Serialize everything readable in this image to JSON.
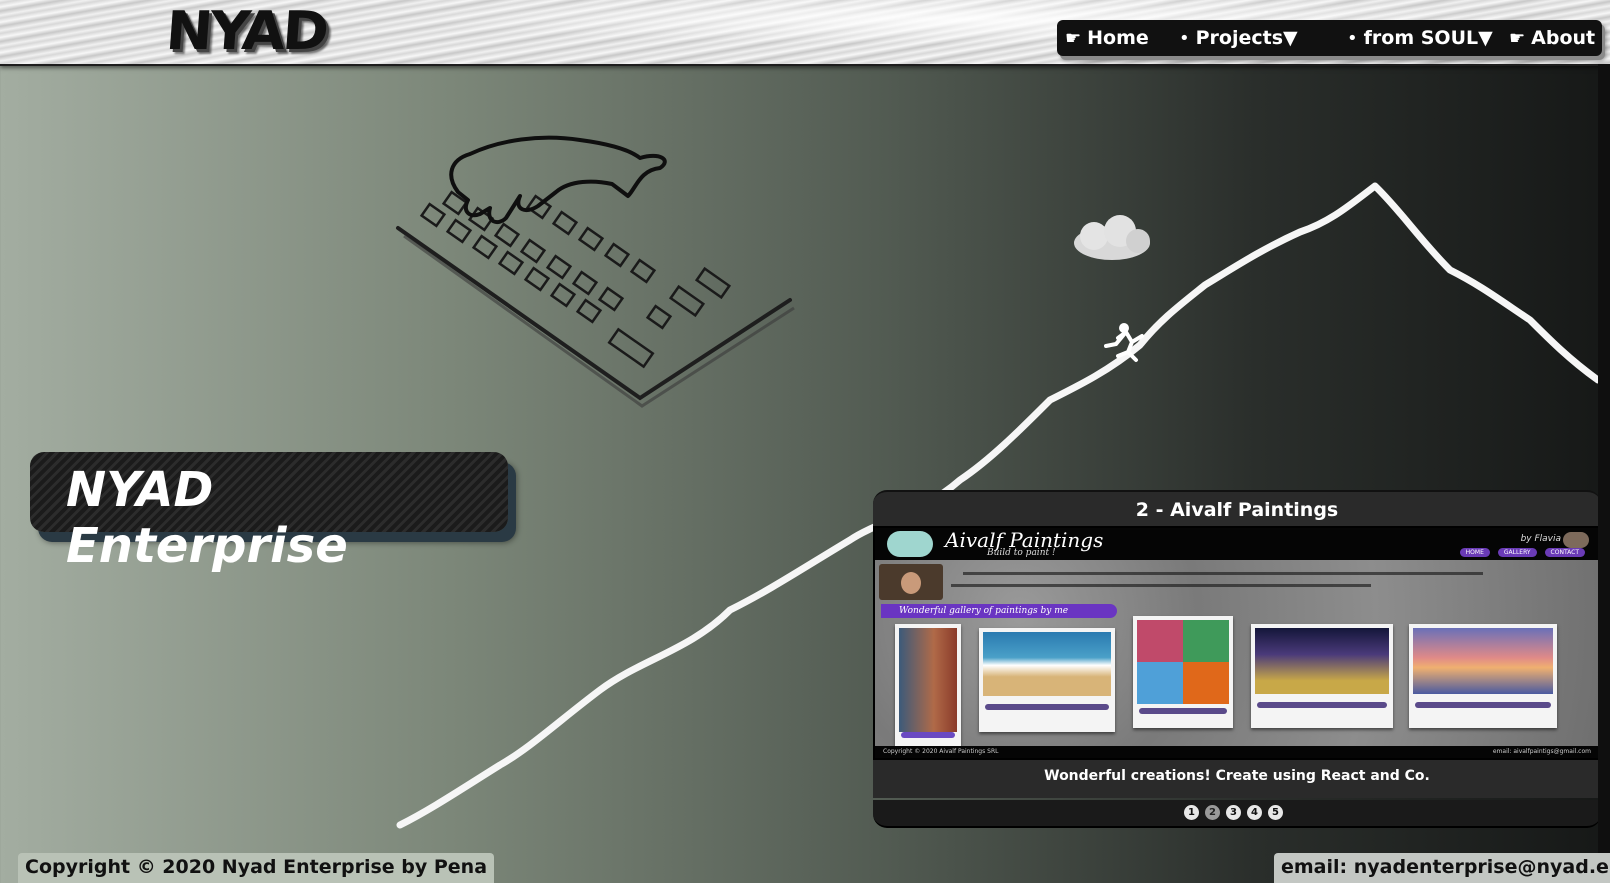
{
  "header": {
    "logo": "NYAD",
    "nav": [
      {
        "glyph": "☛",
        "label": "Home"
      },
      {
        "glyph": "•",
        "label": "Projects▼"
      },
      {
        "glyph": "•",
        "label": "from SOUL▼"
      },
      {
        "glyph": "☛",
        "label": "About"
      }
    ]
  },
  "hero": {
    "title": "NYAD Enterprise"
  },
  "carousel": {
    "slide_title": "2 - Aivalf Paintings",
    "caption": "Wonderful creations! Create using React and Co.",
    "dots": [
      "1",
      "2",
      "3",
      "4",
      "5"
    ],
    "active_dot": 2,
    "preview": {
      "site_title": "Aivalf Paintings",
      "site_subtitle": "Build to paint !",
      "by_label": "by Flavia",
      "menu": [
        "HOME",
        "GALLERY",
        "CONTACT"
      ],
      "gallery_tag": "Wonderful gallery of paintings by me",
      "footer_left": "Copyright © 2020 Aivalf Paintings SRL",
      "footer_right": "email: aivalfpaintigs@gmail.com"
    }
  },
  "footer": {
    "copyright": "Copyright © 2020 Nyad Enterprise by Pena",
    "email": "email: nyadenterprise@nyad.eu"
  },
  "colors": {
    "background_start": "#a3ada1",
    "background_end": "#161817",
    "nav_bg": "#111111",
    "accent_purple": "#6a35c2"
  }
}
